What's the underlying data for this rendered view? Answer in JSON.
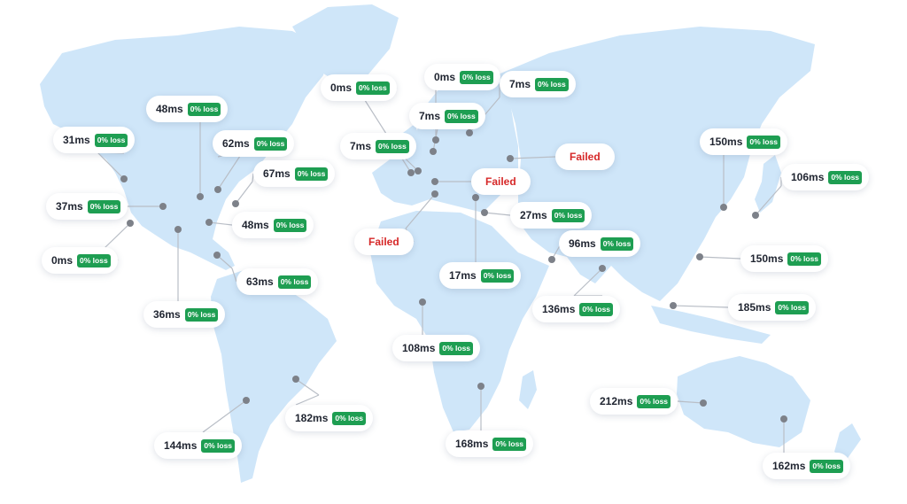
{
  "colors": {
    "land": "#cfe6f9",
    "success_badge": "#1e9e52",
    "failed_text": "#d62828"
  },
  "loss_label": "0% loss",
  "failed_label": "Failed",
  "locations": [
    {
      "id": "alaska",
      "status": "ok",
      "latency": "31ms"
    },
    {
      "id": "canada-north",
      "status": "ok",
      "latency": "48ms"
    },
    {
      "id": "canada-east",
      "status": "ok",
      "latency": "62ms"
    },
    {
      "id": "us-northeast",
      "status": "ok",
      "latency": "67ms"
    },
    {
      "id": "us-northwest",
      "status": "ok",
      "latency": "37ms"
    },
    {
      "id": "us-west",
      "status": "ok",
      "latency": "0ms"
    },
    {
      "id": "us-east",
      "status": "ok",
      "latency": "48ms"
    },
    {
      "id": "caribbean",
      "status": "ok",
      "latency": "63ms"
    },
    {
      "id": "mexico",
      "status": "ok",
      "latency": "36ms"
    },
    {
      "id": "south-america-west",
      "status": "ok",
      "latency": "144ms"
    },
    {
      "id": "brazil",
      "status": "ok",
      "latency": "182ms"
    },
    {
      "id": "uk",
      "status": "ok",
      "latency": "0ms"
    },
    {
      "id": "france",
      "status": "ok",
      "latency": "7ms"
    },
    {
      "id": "scandinavia",
      "status": "ok",
      "latency": "0ms"
    },
    {
      "id": "germany",
      "status": "ok",
      "latency": "7ms"
    },
    {
      "id": "baltic",
      "status": "ok",
      "latency": "7ms"
    },
    {
      "id": "russia",
      "status": "failed"
    },
    {
      "id": "central-europe",
      "status": "failed"
    },
    {
      "id": "spain",
      "status": "failed"
    },
    {
      "id": "turkey",
      "status": "ok",
      "latency": "27ms"
    },
    {
      "id": "middle-east",
      "status": "ok",
      "latency": "17ms"
    },
    {
      "id": "west-africa",
      "status": "ok",
      "latency": "108ms"
    },
    {
      "id": "south-africa",
      "status": "ok",
      "latency": "168ms"
    },
    {
      "id": "uae",
      "status": "ok",
      "latency": "96ms"
    },
    {
      "id": "india",
      "status": "ok",
      "latency": "136ms"
    },
    {
      "id": "korea",
      "status": "ok",
      "latency": "150ms"
    },
    {
      "id": "japan",
      "status": "ok",
      "latency": "106ms"
    },
    {
      "id": "hong-kong",
      "status": "ok",
      "latency": "150ms"
    },
    {
      "id": "singapore",
      "status": "ok",
      "latency": "185ms"
    },
    {
      "id": "australia-west",
      "status": "ok",
      "latency": "212ms"
    },
    {
      "id": "australia-east",
      "status": "ok",
      "latency": "162ms"
    }
  ]
}
